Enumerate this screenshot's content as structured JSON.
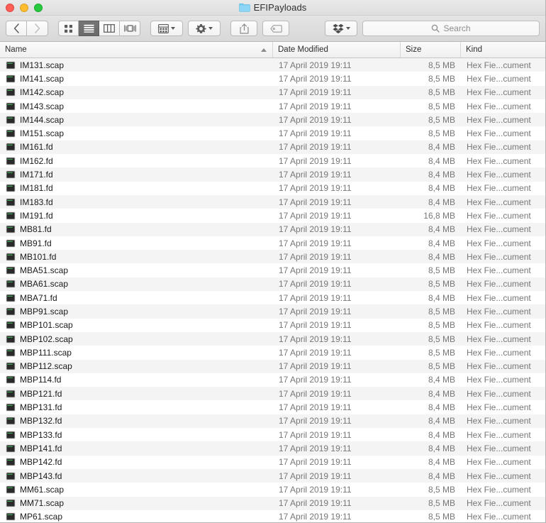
{
  "window": {
    "title": "EFIPayloads",
    "title_icon": "folder-icon",
    "traffic_lights": [
      {
        "name": "close-button",
        "color": "#ff5f57"
      },
      {
        "name": "minimize-button",
        "color": "#febc2e"
      },
      {
        "name": "maximize-button",
        "color": "#28c840"
      }
    ]
  },
  "toolbar": {
    "back_label": "‹",
    "forward_label": "›",
    "view_modes": [
      {
        "name": "icon-view-button",
        "icon": "grid-icon",
        "active": false
      },
      {
        "name": "list-view-button",
        "icon": "list-icon",
        "active": true
      },
      {
        "name": "column-view-button",
        "icon": "columns-icon",
        "active": false
      },
      {
        "name": "coverflow-view-button",
        "icon": "coverflow-icon",
        "active": false
      }
    ],
    "arrange_button": {
      "name": "arrange-by-button",
      "icon": "arrange-icon"
    },
    "action_button": {
      "name": "action-menu-button",
      "icon": "gear-icon"
    },
    "share_button": {
      "name": "share-button",
      "icon": "share-icon"
    },
    "tag_button": {
      "name": "tag-button",
      "icon": "tag-icon"
    },
    "dropbox_button": {
      "name": "dropbox-button",
      "icon": "dropbox-icon"
    },
    "search": {
      "placeholder": "Search",
      "value": "",
      "icon": "search-icon"
    }
  },
  "columns": [
    {
      "key": "name",
      "label": "Name",
      "sorted": true,
      "sort_dir": "ascending"
    },
    {
      "key": "date",
      "label": "Date Modified",
      "sorted": false,
      "sort_dir": ""
    },
    {
      "key": "size",
      "label": "Size",
      "sorted": false,
      "sort_dir": ""
    },
    {
      "key": "kind",
      "label": "Kind",
      "sorted": false,
      "sort_dir": ""
    }
  ],
  "files": [
    {
      "name": "IM131.scap",
      "date": "17 April 2019 19:11",
      "size": "8,5 MB",
      "kind": "Hex Fie...cument"
    },
    {
      "name": "IM141.scap",
      "date": "17 April 2019 19:11",
      "size": "8,5 MB",
      "kind": "Hex Fie...cument"
    },
    {
      "name": "IM142.scap",
      "date": "17 April 2019 19:11",
      "size": "8,5 MB",
      "kind": "Hex Fie...cument"
    },
    {
      "name": "IM143.scap",
      "date": "17 April 2019 19:11",
      "size": "8,5 MB",
      "kind": "Hex Fie...cument"
    },
    {
      "name": "IM144.scap",
      "date": "17 April 2019 19:11",
      "size": "8,5 MB",
      "kind": "Hex Fie...cument"
    },
    {
      "name": "IM151.scap",
      "date": "17 April 2019 19:11",
      "size": "8,5 MB",
      "kind": "Hex Fie...cument"
    },
    {
      "name": "IM161.fd",
      "date": "17 April 2019 19:11",
      "size": "8,4 MB",
      "kind": "Hex Fie...cument"
    },
    {
      "name": "IM162.fd",
      "date": "17 April 2019 19:11",
      "size": "8,4 MB",
      "kind": "Hex Fie...cument"
    },
    {
      "name": "IM171.fd",
      "date": "17 April 2019 19:11",
      "size": "8,4 MB",
      "kind": "Hex Fie...cument"
    },
    {
      "name": "IM181.fd",
      "date": "17 April 2019 19:11",
      "size": "8,4 MB",
      "kind": "Hex Fie...cument"
    },
    {
      "name": "IM183.fd",
      "date": "17 April 2019 19:11",
      "size": "8,4 MB",
      "kind": "Hex Fie...cument"
    },
    {
      "name": "IM191.fd",
      "date": "17 April 2019 19:11",
      "size": "16,8 MB",
      "kind": "Hex Fie...cument"
    },
    {
      "name": "MB81.fd",
      "date": "17 April 2019 19:11",
      "size": "8,4 MB",
      "kind": "Hex Fie...cument"
    },
    {
      "name": "MB91.fd",
      "date": "17 April 2019 19:11",
      "size": "8,4 MB",
      "kind": "Hex Fie...cument"
    },
    {
      "name": "MB101.fd",
      "date": "17 April 2019 19:11",
      "size": "8,4 MB",
      "kind": "Hex Fie...cument"
    },
    {
      "name": "MBA51.scap",
      "date": "17 April 2019 19:11",
      "size": "8,5 MB",
      "kind": "Hex Fie...cument"
    },
    {
      "name": "MBA61.scap",
      "date": "17 April 2019 19:11",
      "size": "8,5 MB",
      "kind": "Hex Fie...cument"
    },
    {
      "name": "MBA71.fd",
      "date": "17 April 2019 19:11",
      "size": "8,4 MB",
      "kind": "Hex Fie...cument"
    },
    {
      "name": "MBP91.scap",
      "date": "17 April 2019 19:11",
      "size": "8,5 MB",
      "kind": "Hex Fie...cument"
    },
    {
      "name": "MBP101.scap",
      "date": "17 April 2019 19:11",
      "size": "8,5 MB",
      "kind": "Hex Fie...cument"
    },
    {
      "name": "MBP102.scap",
      "date": "17 April 2019 19:11",
      "size": "8,5 MB",
      "kind": "Hex Fie...cument"
    },
    {
      "name": "MBP111.scap",
      "date": "17 April 2019 19:11",
      "size": "8,5 MB",
      "kind": "Hex Fie...cument"
    },
    {
      "name": "MBP112.scap",
      "date": "17 April 2019 19:11",
      "size": "8,5 MB",
      "kind": "Hex Fie...cument"
    },
    {
      "name": "MBP114.fd",
      "date": "17 April 2019 19:11",
      "size": "8,4 MB",
      "kind": "Hex Fie...cument"
    },
    {
      "name": "MBP121.fd",
      "date": "17 April 2019 19:11",
      "size": "8,4 MB",
      "kind": "Hex Fie...cument"
    },
    {
      "name": "MBP131.fd",
      "date": "17 April 2019 19:11",
      "size": "8,4 MB",
      "kind": "Hex Fie...cument"
    },
    {
      "name": "MBP132.fd",
      "date": "17 April 2019 19:11",
      "size": "8,4 MB",
      "kind": "Hex Fie...cument"
    },
    {
      "name": "MBP133.fd",
      "date": "17 April 2019 19:11",
      "size": "8,4 MB",
      "kind": "Hex Fie...cument"
    },
    {
      "name": "MBP141.fd",
      "date": "17 April 2019 19:11",
      "size": "8,4 MB",
      "kind": "Hex Fie...cument"
    },
    {
      "name": "MBP142.fd",
      "date": "17 April 2019 19:11",
      "size": "8,4 MB",
      "kind": "Hex Fie...cument"
    },
    {
      "name": "MBP143.fd",
      "date": "17 April 2019 19:11",
      "size": "8,4 MB",
      "kind": "Hex Fie...cument"
    },
    {
      "name": "MM61.scap",
      "date": "17 April 2019 19:11",
      "size": "8,5 MB",
      "kind": "Hex Fie...cument"
    },
    {
      "name": "MM71.scap",
      "date": "17 April 2019 19:11",
      "size": "8,5 MB",
      "kind": "Hex Fie...cument"
    },
    {
      "name": "MP61.scap",
      "date": "17 April 2019 19:11",
      "size": "8,5 MB",
      "kind": "Hex Fie...cument"
    }
  ],
  "file_icon_name": "hex-document-icon",
  "colors": {
    "titlebar": "#e4e4e4",
    "row_stripe": "#f4f4f4",
    "accent_selected": "#6a6a6a",
    "folder_blue": "#6dc6f0"
  }
}
